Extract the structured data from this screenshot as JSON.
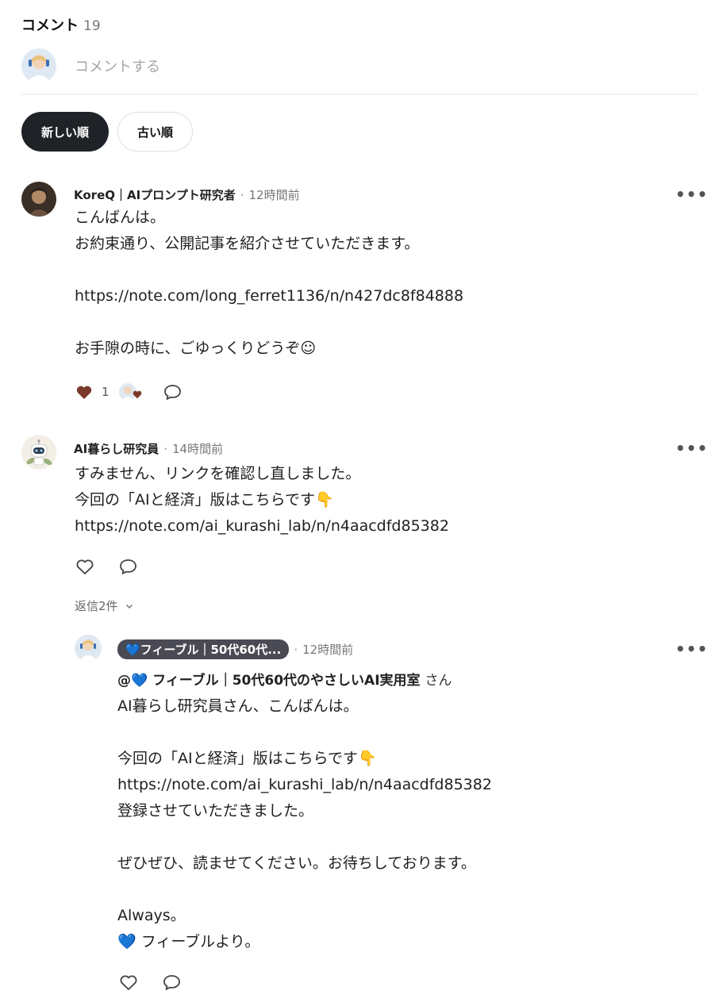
{
  "header": {
    "title": "コメント",
    "count": "19"
  },
  "compose": {
    "placeholder": "コメントする"
  },
  "sort": {
    "newest_label": "新しい順",
    "oldest_label": "古い順"
  },
  "comments": [
    {
      "author": "KoreQ｜AIプロンプト研究者",
      "time": "12時間前",
      "lines": [
        "こんばんは。",
        "お約束通り、公開記事を紹介させていただきます。",
        "",
        "https://note.com/long_ferret1136/n/n427dc8f84888",
        "",
        "お手隙の時に、ごゆっくりどうぞ☺"
      ],
      "likes": "1"
    },
    {
      "author": "AI暮らし研究員",
      "time": "14時間前",
      "lines": [
        "すみません、リンクを確認し直しました。",
        "今回の「AIと経済」版はこちらです👇",
        "https://note.com/ai_kurashi_lab/n/n4aacdfd85382"
      ],
      "replies_toggle": "返信2件"
    }
  ],
  "reply": {
    "author_badge": "💙フィーブル｜50代60代...",
    "time": "12時間前",
    "mention_name": "@💙 フィーブル｜50代60代のやさしいAI実用室",
    "mention_suffix": "さん",
    "lines": [
      "AI暮らし研究員さん、こんばんは。",
      "",
      "今回の「AIと経済」版はこちらです👇",
      "https://note.com/ai_kurashi_lab/n/n4aacdfd85382",
      "登録させていただきました。",
      "",
      "ぜひぜひ、読ませてください。お待ちしております。",
      "",
      "Always。",
      "💙 フィーブルより。"
    ]
  },
  "icons": {
    "more": "more-icon",
    "heart": "heart-icon",
    "comment": "comment-icon",
    "chevron": "chevron-down-icon"
  },
  "colors": {
    "sort_active_bg": "#1f2328",
    "liked_heart": "#7a3a2a",
    "badge_bg": "#4a4a55"
  }
}
